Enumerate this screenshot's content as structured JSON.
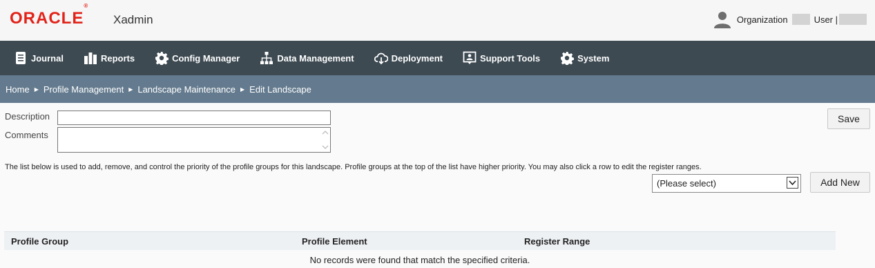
{
  "header": {
    "logo_text": "ORACLE",
    "logo_mark": "®",
    "app_name": "Xadmin",
    "organization_label": "Organization",
    "user_label": "User |"
  },
  "nav": {
    "items": [
      {
        "label": "Journal",
        "icon": "journal-icon"
      },
      {
        "label": "Reports",
        "icon": "bar-chart-icon"
      },
      {
        "label": "Config Manager",
        "icon": "gear-icon"
      },
      {
        "label": "Data Management",
        "icon": "hierarchy-icon"
      },
      {
        "label": "Deployment",
        "icon": "cloud-download-icon"
      },
      {
        "label": "Support Tools",
        "icon": "support-icon"
      },
      {
        "label": "System",
        "icon": "gear-icon"
      }
    ]
  },
  "breadcrumb": [
    "Home",
    "Profile Management",
    "Landscape Maintenance",
    "Edit Landscape"
  ],
  "form": {
    "description_label": "Description",
    "description_value": "",
    "comments_label": "Comments",
    "comments_value": "",
    "save_label": "Save"
  },
  "info_text": "The list below is used to add, remove, and control the priority of the profile groups for this landscape. Profile groups at the top of the list have higher priority. You may also click a row to edit the register ranges.",
  "group_select": {
    "selected": "(Please select)"
  },
  "add_new_label": "Add New",
  "table": {
    "columns": [
      "Profile Group",
      "Profile Element",
      "Register Range"
    ],
    "empty_message": "No records were found that match the specified criteria."
  },
  "colors": {
    "brand": "#e2231a",
    "nav_bg": "#3d4a52",
    "breadcrumb_bg": "#647b8f"
  }
}
